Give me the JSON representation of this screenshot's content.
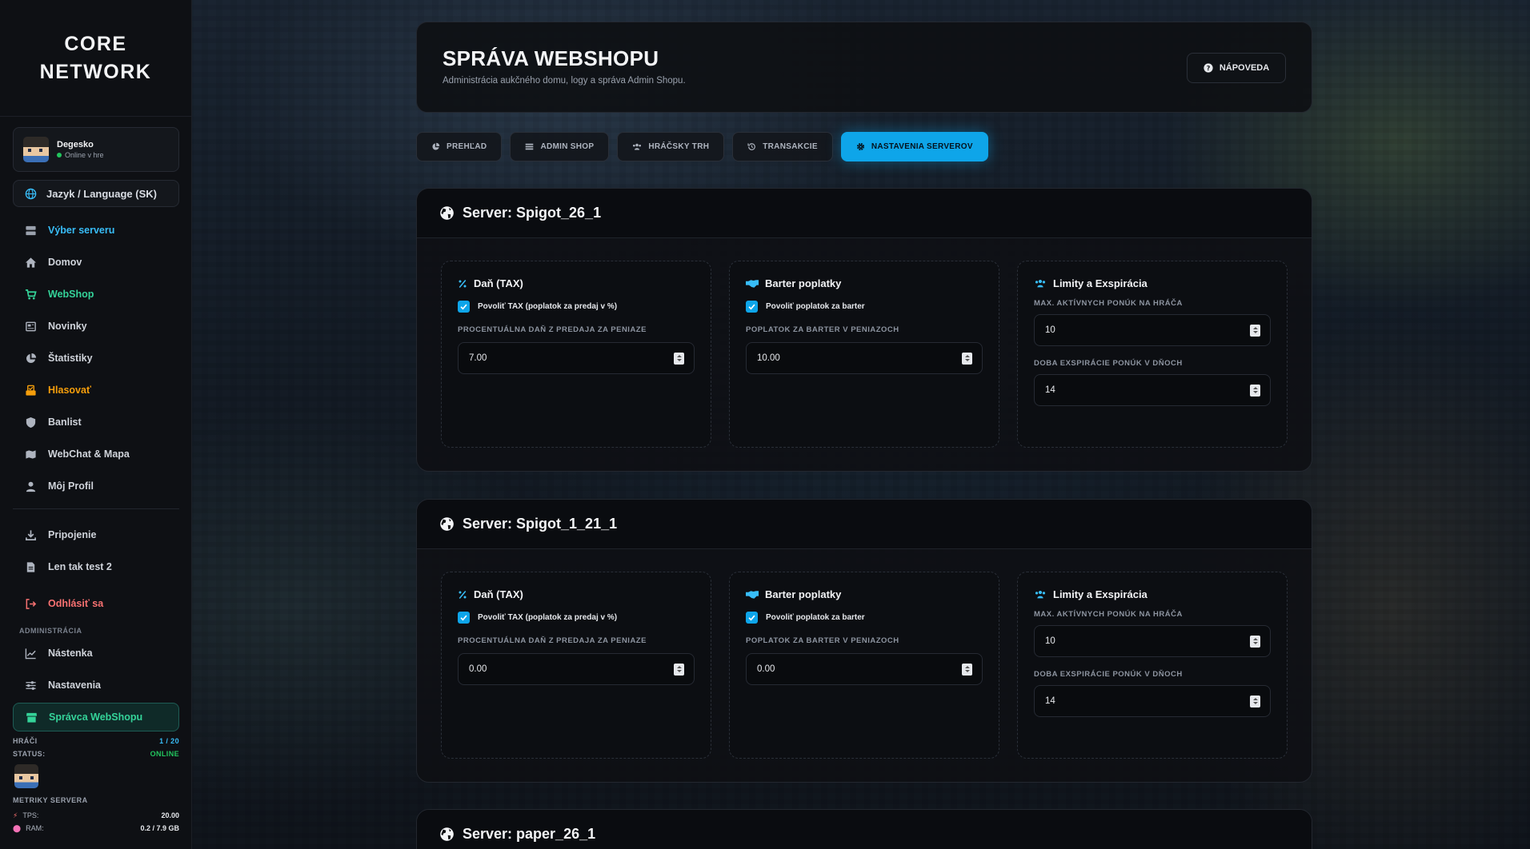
{
  "brand": {
    "line1": "CORE",
    "line2": "NETWORK"
  },
  "user": {
    "name": "Degesko",
    "status": "Online v hre"
  },
  "language_button": "Jazyk / Language (SK)",
  "nav": {
    "server_select": "Výber serveru",
    "home": "Domov",
    "webshop": "WebShop",
    "news": "Novinky",
    "stats": "Štatistiky",
    "vote": "Hlasovať",
    "banlist": "Banlist",
    "webchat": "WebChat & Mapa",
    "profile": "Môj Profil",
    "connect": "Pripojenie",
    "test": "Len tak test 2",
    "logout": "Odhlásiť sa",
    "admin_section": "ADMINISTRÁCIA",
    "dashboard": "Nástenka",
    "settings": "Nastavenia",
    "webshop_admin": "Správca WebShopu"
  },
  "server_stats": {
    "players_label": "HRÁČI",
    "players_value": "1 / 20",
    "status_label": "STATUS:",
    "status_value": "ONLINE",
    "metrics_title": "METRIKY SERVERA",
    "tps_label": "TPS:",
    "tps_value": "20.00",
    "ram_label": "RAM:",
    "ram_value": "0.2 / 7.9 GB"
  },
  "header": {
    "title": "SPRÁVA WEBSHOPU",
    "subtitle": "Administrácia aukčného domu, logy a správa Admin Shopu.",
    "help_label": "NÁPOVEDA"
  },
  "tabs": [
    {
      "label": "PREHĽAD",
      "icon": "pie-chart-icon"
    },
    {
      "label": "ADMIN SHOP",
      "icon": "list-icon"
    },
    {
      "label": "HRÁČSKY TRH",
      "icon": "users-icon"
    },
    {
      "label": "TRANSAKCIE",
      "icon": "history-icon"
    },
    {
      "label": "NASTAVENIA SERVEROV",
      "icon": "gear-icon"
    }
  ],
  "panel_titles": {
    "tax": "Daň (TAX)",
    "barter": "Barter poplatky",
    "limits": "Limity a Exspirácia"
  },
  "labels": {
    "tax_enable": "Povoliť TAX (poplatok za predaj v %)",
    "tax_percent": "PROCENTUÁLNA DAŇ Z PREDAJA ZA PENIAZE",
    "barter_enable": "Povoliť poplatok za barter",
    "barter_fee": "POPLATOK ZA BARTER V PENIAZOCH",
    "max_offers": "MAX. AKTÍVNYCH PONÚK NA HRÁČA",
    "expiry_days": "DOBA EXSPIRÁCIE PONÚK V DŇOCH"
  },
  "servers": [
    {
      "title": "Server: Spigot_26_1",
      "tax_enabled": true,
      "tax_value": "7.00",
      "barter_enabled": true,
      "barter_value": "10.00",
      "max_offers": "10",
      "expiry_days": "14"
    },
    {
      "title": "Server: Spigot_1_21_1",
      "tax_enabled": true,
      "tax_value": "0.00",
      "barter_enabled": true,
      "barter_value": "0.00",
      "max_offers": "10",
      "expiry_days": "14"
    },
    {
      "title": "Server: paper_26_1"
    }
  ],
  "colors": {
    "accent_blue": "#0ea5e9",
    "accent_green": "#34d399",
    "accent_orange": "#f59e0b",
    "accent_red": "#f87171"
  }
}
